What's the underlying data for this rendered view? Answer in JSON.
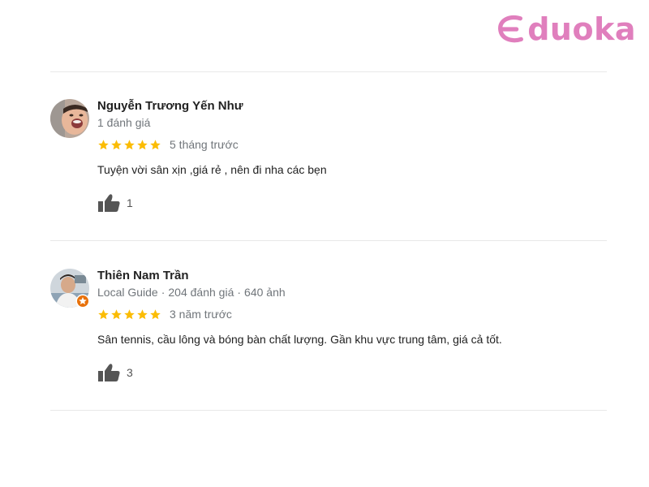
{
  "brand": {
    "logo_text": "duoka",
    "color": "#e07fbd"
  },
  "colors": {
    "star": "#fbbc04",
    "name": "#222222",
    "meta": "#70757a",
    "thumb": "#555555",
    "divider": "#e8e8e8",
    "guide_badge": "#e8710a"
  },
  "reviews": [
    {
      "name": "Nguyễn Trương Yến Như",
      "meta": "1 đánh giá",
      "rating": 5,
      "time": "5 tháng trước",
      "text": "Tuyện vời sân xịn ,giá rẻ , nên đi nha các bẹn",
      "likes": "1",
      "avatar_icon": "user-avatar-photo",
      "local_guide": false
    },
    {
      "name": "Thiên Nam Trần",
      "meta_guide": "Local Guide",
      "meta_reviews": "204 đánh giá",
      "meta_photos": "640 ảnh",
      "rating": 5,
      "time": "3 năm trước",
      "text": "Sân tennis, cầu lông và bóng bàn chất lượng. Gần khu vực trung tâm, giá cả tốt.",
      "likes": "3",
      "avatar_icon": "user-avatar-photo",
      "local_guide": true
    }
  ]
}
